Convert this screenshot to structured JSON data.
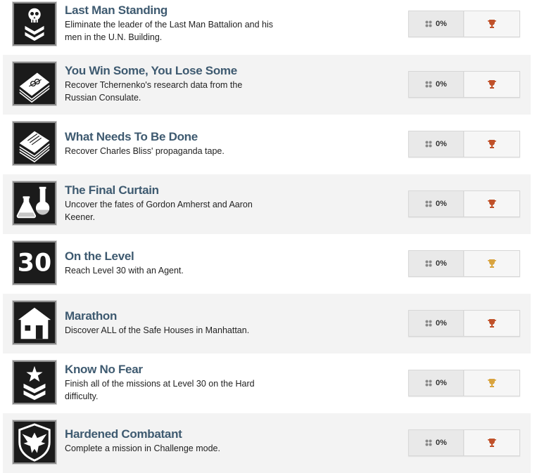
{
  "achievements": [
    {
      "title": "Last Man Standing",
      "desc": "Eliminate the leader of the Last Man Battalion and his men in the U.N. Building.",
      "percent": "0%",
      "icon": "skull-chevron-icon",
      "trophy_color": "#c0512a"
    },
    {
      "title": "You Win Some, You Lose Some",
      "desc": "Recover Tchernenko's research data from the Russian Consulate.",
      "percent": "0%",
      "icon": "research-papers-icon",
      "trophy_color": "#c0512a"
    },
    {
      "title": "What Needs To Be Done",
      "desc": "Recover Charles Bliss' propaganda tape.",
      "percent": "0%",
      "icon": "document-stack-icon",
      "trophy_color": "#c0512a"
    },
    {
      "title": "The Final Curtain",
      "desc": "Uncover the fates of Gordon Amherst and Aaron Keener.",
      "percent": "0%",
      "icon": "lab-flasks-icon",
      "trophy_color": "#c0512a"
    },
    {
      "title": "On the Level",
      "desc": "Reach Level 30 with an Agent.",
      "percent": "0%",
      "icon": "level-30-icon",
      "icon_text": "30",
      "trophy_color": "#d9a43f"
    },
    {
      "title": "Marathon",
      "desc": "Discover ALL of the Safe Houses in Manhattan.",
      "percent": "0%",
      "icon": "safe-house-icon",
      "trophy_color": "#c0512a"
    },
    {
      "title": "Know No Fear",
      "desc": "Finish all of the missions at Level 30 on the Hard difficulty.",
      "percent": "0%",
      "icon": "star-chevron-icon",
      "trophy_color": "#d9a43f"
    },
    {
      "title": "Hardened Combatant",
      "desc": "Complete a mission in Challenge mode.",
      "percent": "0%",
      "icon": "eagle-shield-icon",
      "trophy_color": "#c0512a"
    }
  ]
}
